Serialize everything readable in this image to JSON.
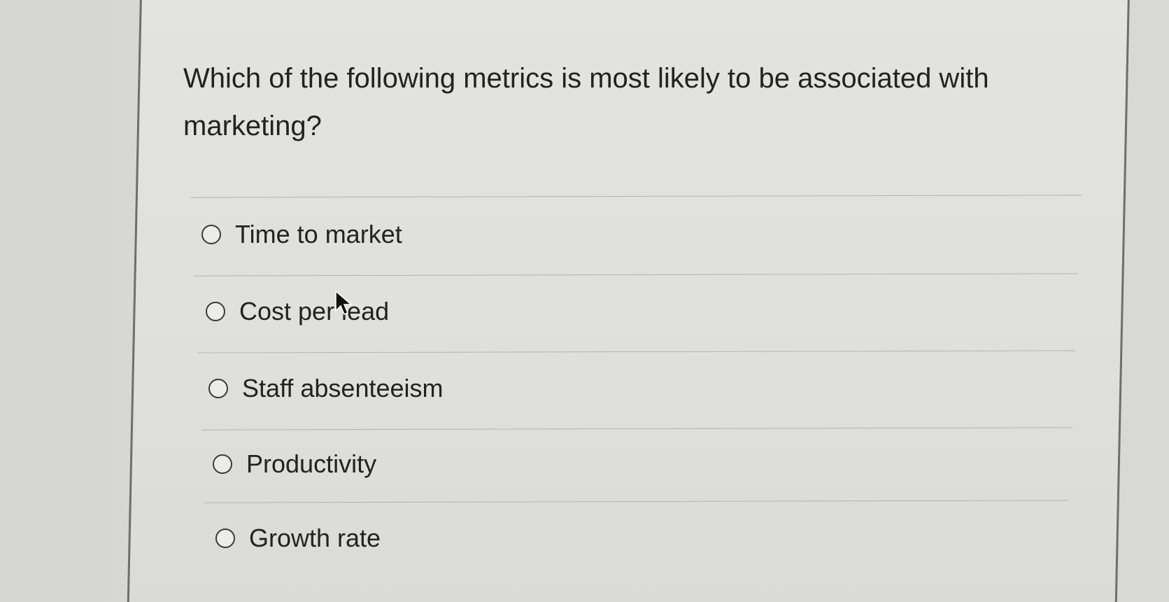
{
  "quiz": {
    "question": "Which of the following metrics is most likely to be associated with marketing?",
    "options": [
      {
        "label": "Time to market",
        "selected": false
      },
      {
        "label": "Cost per lead",
        "selected": false
      },
      {
        "label": "Staff absenteeism",
        "selected": false
      },
      {
        "label": "Productivity",
        "selected": false
      },
      {
        "label": "Growth rate",
        "selected": false
      }
    ]
  },
  "cursor": {
    "icon": "mouse-pointer-icon"
  }
}
